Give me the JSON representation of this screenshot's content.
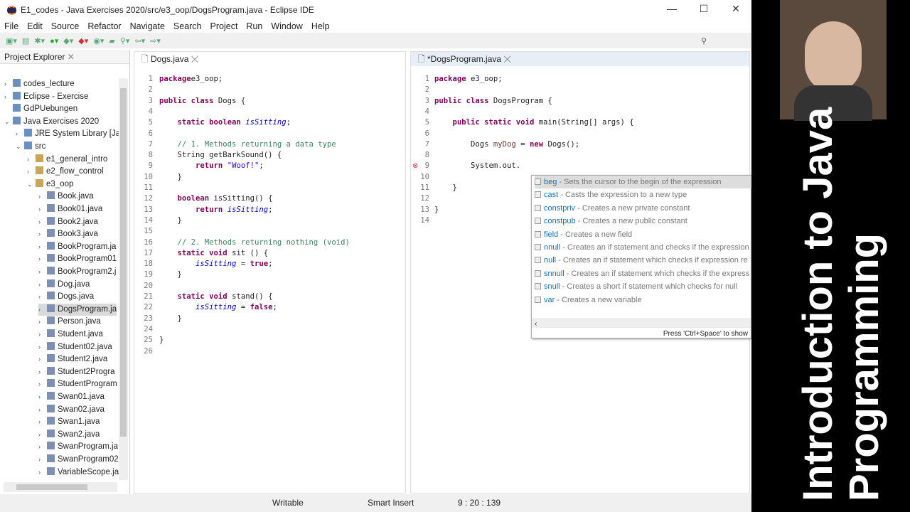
{
  "window": {
    "title": "E1_codes - Java Exercises 2020/src/e3_oop/DogsProgram.java - Eclipse IDE"
  },
  "menu": [
    "File",
    "Edit",
    "Source",
    "Refactor",
    "Navigate",
    "Search",
    "Project",
    "Run",
    "Window",
    "Help"
  ],
  "explorer": {
    "title": "Project Explorer",
    "items": [
      {
        "label": "codes_lecture",
        "depth": 0,
        "tw": "›"
      },
      {
        "label": "Eclipse - Exercise",
        "depth": 0,
        "tw": "›"
      },
      {
        "label": "GdPUebungen",
        "depth": 0,
        "tw": ""
      },
      {
        "label": "Java Exercises 2020",
        "depth": 0,
        "tw": "⌄"
      },
      {
        "label": "JRE System Library [Ja",
        "depth": 1,
        "tw": "›"
      },
      {
        "label": "src",
        "depth": 1,
        "tw": "⌄"
      },
      {
        "label": "e1_general_intro",
        "depth": 2,
        "tw": "›"
      },
      {
        "label": "e2_flow_control",
        "depth": 2,
        "tw": "›"
      },
      {
        "label": "e3_oop",
        "depth": 2,
        "tw": "⌄"
      },
      {
        "label": "Book.java",
        "depth": 3,
        "tw": "›"
      },
      {
        "label": "Book01.java",
        "depth": 3,
        "tw": "›"
      },
      {
        "label": "Book2.java",
        "depth": 3,
        "tw": "›"
      },
      {
        "label": "Book3.java",
        "depth": 3,
        "tw": "›"
      },
      {
        "label": "BookProgram.ja",
        "depth": 3,
        "tw": "›"
      },
      {
        "label": "BookProgram01",
        "depth": 3,
        "tw": "›"
      },
      {
        "label": "BookProgram2.j",
        "depth": 3,
        "tw": "›"
      },
      {
        "label": "Dog.java",
        "depth": 3,
        "tw": "›"
      },
      {
        "label": "Dogs.java",
        "depth": 3,
        "tw": "›"
      },
      {
        "label": "DogsProgram.ja",
        "depth": 3,
        "tw": "›",
        "selected": true
      },
      {
        "label": "Person.java",
        "depth": 3,
        "tw": "›"
      },
      {
        "label": "Student.java",
        "depth": 3,
        "tw": "›"
      },
      {
        "label": "Student02.java",
        "depth": 3,
        "tw": "›"
      },
      {
        "label": "Student2.java",
        "depth": 3,
        "tw": "›"
      },
      {
        "label": "Student2Progra",
        "depth": 3,
        "tw": "›"
      },
      {
        "label": "StudentProgram",
        "depth": 3,
        "tw": "›"
      },
      {
        "label": "Swan01.java",
        "depth": 3,
        "tw": "›"
      },
      {
        "label": "Swan02.java",
        "depth": 3,
        "tw": "›"
      },
      {
        "label": "Swan1.java",
        "depth": 3,
        "tw": "›"
      },
      {
        "label": "Swan2.java",
        "depth": 3,
        "tw": "›"
      },
      {
        "label": "SwanProgram.ja",
        "depth": 3,
        "tw": "›"
      },
      {
        "label": "SwanProgram02",
        "depth": 3,
        "tw": "›"
      },
      {
        "label": "VariableScope.ja",
        "depth": 3,
        "tw": "›"
      }
    ]
  },
  "editor_left": {
    "tab": "Dogs.java",
    "lines": [
      [
        [
          "kw",
          "package"
        ],
        [
          "",
          "e3_oop;"
        ]
      ],
      [],
      [
        [
          "kw",
          "public class"
        ],
        [
          "",
          " Dogs {"
        ]
      ],
      [],
      [
        [
          "",
          "    "
        ],
        [
          "kw",
          "static boolean"
        ],
        [
          "",
          " "
        ],
        [
          "fd",
          "isSitting"
        ],
        [
          "",
          ";"
        ]
      ],
      [],
      [
        [
          "",
          "    "
        ],
        [
          "cm",
          "// 1. Methods returning a data type"
        ]
      ],
      [
        [
          "",
          "    String getBarkSound() {"
        ]
      ],
      [
        [
          "",
          "        "
        ],
        [
          "kw",
          "return"
        ],
        [
          "",
          " "
        ],
        [
          "st",
          "\"Woof!\""
        ],
        [
          "",
          ";"
        ]
      ],
      [
        [
          "",
          "    }"
        ]
      ],
      [],
      [
        [
          "",
          "    "
        ],
        [
          "kw",
          "boolean"
        ],
        [
          "",
          " isSitting() {"
        ]
      ],
      [
        [
          "",
          "        "
        ],
        [
          "kw",
          "return"
        ],
        [
          "",
          " "
        ],
        [
          "fd",
          "isSitting"
        ],
        [
          "",
          ";"
        ]
      ],
      [
        [
          "",
          "    }"
        ]
      ],
      [],
      [
        [
          "",
          "    "
        ],
        [
          "cm",
          "// 2. Methods returning nothing (void)"
        ]
      ],
      [
        [
          "",
          "    "
        ],
        [
          "kw",
          "static void"
        ],
        [
          "",
          " sit () {"
        ]
      ],
      [
        [
          "",
          "        "
        ],
        [
          "fd",
          "isSitting"
        ],
        [
          "",
          " = "
        ],
        [
          "kw",
          "true"
        ],
        [
          "",
          ";"
        ]
      ],
      [
        [
          "",
          "    }"
        ]
      ],
      [],
      [
        [
          "",
          "    "
        ],
        [
          "kw",
          "static void"
        ],
        [
          "",
          " stand() {"
        ]
      ],
      [
        [
          "",
          "        "
        ],
        [
          "fd",
          "isSitting"
        ],
        [
          "",
          " = "
        ],
        [
          "kw",
          "false"
        ],
        [
          "",
          ";"
        ]
      ],
      [
        [
          "",
          "    }"
        ]
      ],
      [],
      [
        [
          "",
          "}"
        ]
      ],
      []
    ]
  },
  "editor_right": {
    "tab": "*DogsProgram.java",
    "lines": [
      [
        [
          "kw",
          "package"
        ],
        [
          "",
          " e3_oop;"
        ]
      ],
      [],
      [
        [
          "kw",
          "public class"
        ],
        [
          "",
          " DogsProgram {"
        ]
      ],
      [],
      [
        [
          "",
          "    "
        ],
        [
          "kw",
          "public static void"
        ],
        [
          "",
          " main(String[] args) {"
        ]
      ],
      [],
      [
        [
          "",
          "        Dogs "
        ],
        [
          "lv",
          "myDog"
        ],
        [
          "",
          " = "
        ],
        [
          "kw",
          "new"
        ],
        [
          "",
          " Dogs();"
        ]
      ],
      [],
      [
        [
          "",
          "        System."
        ],
        [
          "",
          "out."
        ]
      ],
      [],
      [
        [
          "",
          "    }"
        ]
      ],
      [],
      [
        [
          "",
          "}"
        ]
      ],
      []
    ]
  },
  "completion": {
    "items": [
      {
        "name": "beg",
        "desc": "Sets the cursor to the begin of the expression"
      },
      {
        "name": "cast",
        "desc": "Casts the expression to a new type"
      },
      {
        "name": "constpriv",
        "desc": "Creates a new private constant"
      },
      {
        "name": "constpub",
        "desc": "Creates a new public constant"
      },
      {
        "name": "field",
        "desc": "Creates a new field"
      },
      {
        "name": "nnull",
        "desc": "Creates an if statement and checks if the expression"
      },
      {
        "name": "null",
        "desc": "Creates an if statement which checks if expression re"
      },
      {
        "name": "snnull",
        "desc": "Creates an if statement which checks if the express"
      },
      {
        "name": "snull",
        "desc": "Creates a short if statement which checks for null"
      },
      {
        "name": "var",
        "desc": "Creates a new variable"
      }
    ],
    "hint": "Press 'Ctrl+Space' to show"
  },
  "status": {
    "mode": "Writable",
    "insert": "Smart Insert",
    "position": "9 : 20 : 139"
  },
  "video": {
    "line1": "Introduction to Java",
    "line2": "Programming"
  }
}
